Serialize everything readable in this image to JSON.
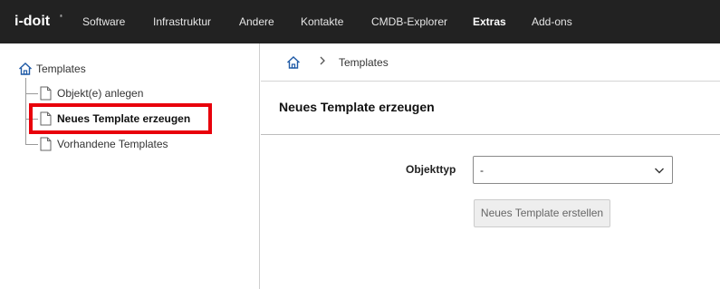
{
  "app": {
    "logo_text": "i-doit"
  },
  "topnav": {
    "items": [
      {
        "label": "Software",
        "active": false
      },
      {
        "label": "Infrastruktur",
        "active": false
      },
      {
        "label": "Andere",
        "active": false
      },
      {
        "label": "Kontakte",
        "active": false
      },
      {
        "label": "CMDB-Explorer",
        "active": false
      },
      {
        "label": "Extras",
        "active": true
      },
      {
        "label": "Add-ons",
        "active": false
      }
    ]
  },
  "sidebar": {
    "root_label": "Templates",
    "items": [
      {
        "label": "Objekt(e) anlegen",
        "selected": false,
        "icon": "document-icon"
      },
      {
        "label": "Neues Template erzeugen",
        "selected": true,
        "icon": "document-icon"
      },
      {
        "label": "Vorhandene Templates",
        "selected": false,
        "icon": "document-icon"
      }
    ]
  },
  "breadcrumb": {
    "home_icon": "home-icon",
    "separator": "›",
    "current": "Templates"
  },
  "main": {
    "title": "Neues Template erzeugen",
    "objekttyp_label": "Objekttyp",
    "objekttyp_value": "-",
    "create_button_label": "Neues Template erstellen"
  },
  "colors": {
    "topbar_bg": "#222222",
    "highlight": "#e8000b",
    "button_disabled_bg": "#eeeeee"
  }
}
